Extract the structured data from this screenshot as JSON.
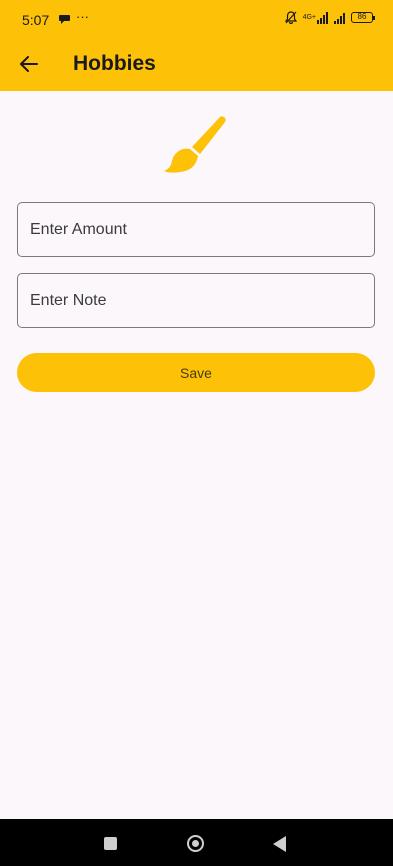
{
  "status_bar": {
    "time": "5:07",
    "dots": "···",
    "network": "4G+",
    "battery": "86"
  },
  "app_bar": {
    "title": "Hobbies",
    "back_icon": "arrow-left-icon"
  },
  "hero_icon": "paintbrush-icon",
  "form": {
    "amount_placeholder": "Enter Amount",
    "note_placeholder": "Enter Note",
    "save_label": "Save"
  },
  "colors": {
    "primary": "#fdc108",
    "background": "#fcf7fb",
    "outline": "#7c7a80"
  },
  "nav_bar": {
    "icons": [
      "recents-icon",
      "home-icon",
      "back-icon"
    ]
  }
}
